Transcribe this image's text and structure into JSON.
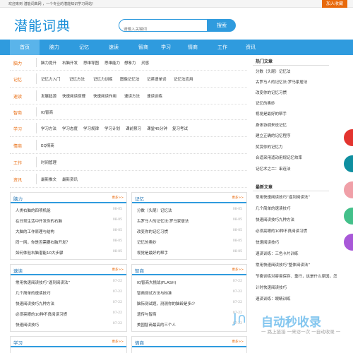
{
  "topbar": {
    "welcome": "欢迎来到 潜能词典网 ，一个专业的潜能知识学习网站！",
    "join": "加入收藏"
  },
  "logo": "潜能词典",
  "search": {
    "placeholder": "请输入关键词",
    "button": "搜索"
  },
  "nav": [
    "首页",
    "脑力",
    "记忆",
    "速读",
    "智商",
    "学习",
    "情商",
    "工作",
    "资讯"
  ],
  "categories": [
    {
      "name": "脑力",
      "links": [
        "脑力提升",
        "右脑开发",
        "思维导图",
        "思维能力",
        "想象力",
        "灵感"
      ]
    },
    {
      "name": "记忆",
      "links": [
        "记忆力入门",
        "记忆方法",
        "记忆力训练",
        "图像记忆法",
        "记英语单词",
        "记忆法应用"
      ]
    },
    {
      "name": "速读",
      "links": [
        "发展起源",
        "快速阅读原理",
        "快速阅读作用",
        "速读方法",
        "速读训练"
      ]
    },
    {
      "name": "智商",
      "links": [
        "IQ智商"
      ]
    },
    {
      "name": "学习",
      "links": [
        "学习方法",
        "学习态度",
        "学习规律",
        "学习计划",
        "课前预习",
        "课堂45分钟",
        "复习考试"
      ]
    },
    {
      "name": "情商",
      "links": [
        "EQ情商"
      ]
    },
    {
      "name": "工作",
      "links": [
        "时间管理"
      ]
    },
    {
      "name": "资讯",
      "links": [
        "最新推文",
        "最新资讯"
      ]
    }
  ],
  "panels": [
    {
      "title": "脑力",
      "more": "更多>>",
      "items": [
        {
          "t": "人类右脑的四项机能",
          "d": "08-05"
        },
        {
          "t": "在日常生活中开发你的右脑",
          "d": "08-05"
        },
        {
          "t": "大脑的工作原理与结构",
          "d": "08-05"
        },
        {
          "t": "同一网，你是否需要右脑开发？",
          "d": "08-05"
        },
        {
          "t": "如何体验右脑潜能10大步骤",
          "d": "08-05"
        }
      ]
    },
    {
      "title": "记忆",
      "more": "更多>>",
      "items": [
        {
          "t": "分数（头尾）记忆法",
          "d": "08-05"
        },
        {
          "t": "古罗马人的记忆法:罗马家居法",
          "d": "08-05"
        },
        {
          "t": "改变你的记忆习惯",
          "d": "08-05"
        },
        {
          "t": "记忆的奥妙",
          "d": "08-05"
        },
        {
          "t": "视觉是最好的帮手",
          "d": "08-05"
        }
      ]
    },
    {
      "title": "速读",
      "more": "更多>>",
      "items": [
        {
          "t": "常用快速阅读技巧“逼到阅读法”",
          "d": "07-22"
        },
        {
          "t": "几个简单的速读技巧",
          "d": "07-22"
        },
        {
          "t": "快速阅读技巧九种方法",
          "d": "07-22"
        },
        {
          "t": "必须亮眼的10种不良阅读习惯",
          "d": "07-22"
        },
        {
          "t": "快速阅读技巧",
          "d": "07-22"
        }
      ]
    },
    {
      "title": "智商",
      "more": "更多>>",
      "items": [
        {
          "t": "IQ智商大挑战(FLASH)",
          "d": "07-22"
        },
        {
          "t": "智商测试方法与标准",
          "d": "07-22"
        },
        {
          "t": "脑际测试题，测测你的脑龄是多少",
          "d": "07-22"
        },
        {
          "t": "遗传与智商",
          "d": "07-22"
        },
        {
          "t": "美国智商最高的三个人",
          "d": "07-22"
        }
      ]
    },
    {
      "title": "学习",
      "more": "更多>>",
      "items": []
    },
    {
      "title": "情商",
      "more": "更多>>",
      "items": []
    }
  ],
  "sidebar": {
    "hot_title": "热门文章",
    "hot": [
      "分数（头尾）记忆法",
      "古罗马人的记忆法:罗马家居法",
      "改变你的记忆习惯",
      "记忆的奥妙",
      "视觉是最好的帮手",
      "身体协调来说记忆",
      "建立正确的记忆程序",
      "奖赏你的记忆力",
      "合适采用适动用规记忆效率",
      "记忆术之二：串连法"
    ],
    "new_title": "最新文章",
    "new": [
      "常用快速阅读技巧“逼到阅读法”",
      "几个简单的速读技巧",
      "快速阅读技巧九种方法",
      "必须亮眼的10种不良阅读习惯",
      "快速阅读技巧",
      "速读训练：三色卡片训练",
      "常用快速阅读技巧“整体阅读法”",
      "节奏训练对容易保存、重行，这是什么原因，怎",
      "计时快速阅读技巧",
      "速读训练：眼睛训练"
    ]
  },
  "watermark": {
    "brand": "自动秒收录",
    "sub": "一 路上链接 一来访一次 一自动收录 一"
  },
  "colors": {
    "accent": "#2f9bde",
    "orange": "#e8690b",
    "float_red": "#e3342f",
    "float_teal": "#0f8fa0",
    "float_pink": "#f0a0a8",
    "float_green": "#43c08a",
    "float_purple": "#a858d8"
  }
}
